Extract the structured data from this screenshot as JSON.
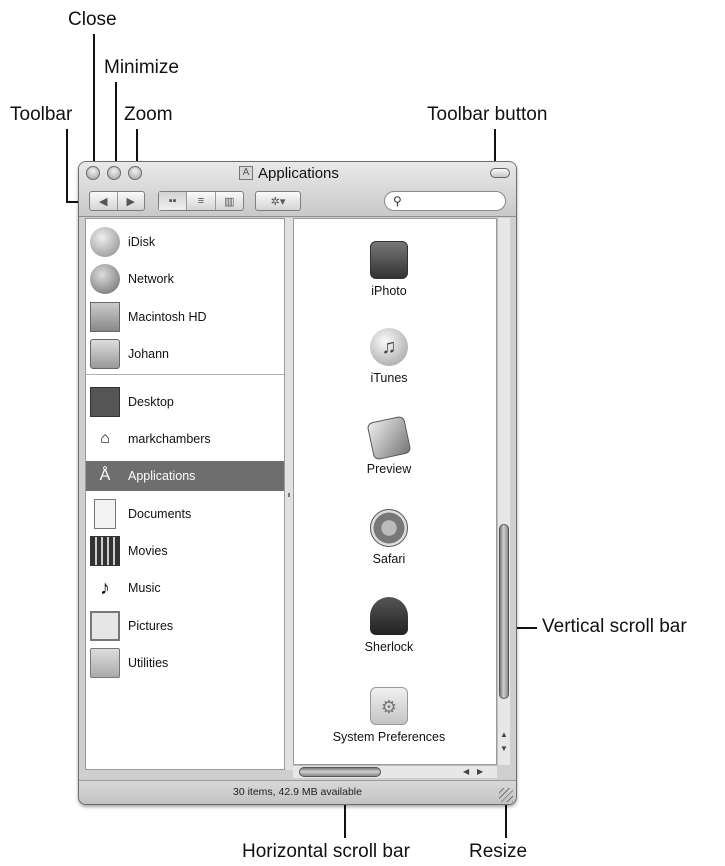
{
  "callouts": {
    "close": "Close",
    "minimize": "Minimize",
    "toolbar": "Toolbar",
    "zoom": "Zoom",
    "toolbar_button": "Toolbar button",
    "vertical_scroll_bar": "Vertical scroll bar",
    "horizontal_scroll_bar": "Horizontal scroll bar",
    "resize": "Resize"
  },
  "window": {
    "title": "Applications",
    "status": "30 items, 42.9 MB available"
  },
  "toolbar": {
    "back_glyph": "◀",
    "forward_glyph": "▶",
    "view_icon_glyph": "▪▪",
    "view_list_glyph": "≡",
    "view_column_glyph": "▥",
    "action_glyph": "✲▾",
    "search_glyph": "⚲"
  },
  "sidebar": {
    "items": [
      {
        "label": "iDisk",
        "icon": "idisk-icon"
      },
      {
        "label": "Network",
        "icon": "network-icon"
      },
      {
        "label": "Macintosh HD",
        "icon": "hard-drive-icon"
      },
      {
        "label": "Johann",
        "icon": "external-drive-icon"
      },
      {
        "label": "Desktop",
        "icon": "desktop-icon"
      },
      {
        "label": "markchambers",
        "icon": "home-icon"
      },
      {
        "label": "Applications",
        "icon": "applications-icon",
        "selected": true
      },
      {
        "label": "Documents",
        "icon": "documents-icon"
      },
      {
        "label": "Movies",
        "icon": "movies-icon"
      },
      {
        "label": "Music",
        "icon": "music-icon"
      },
      {
        "label": "Pictures",
        "icon": "pictures-icon"
      },
      {
        "label": "Utilities",
        "icon": "utilities-folder-icon"
      }
    ]
  },
  "apps": [
    {
      "label": "iPhoto",
      "icon": "iphoto-icon"
    },
    {
      "label": "iTunes",
      "icon": "itunes-icon"
    },
    {
      "label": "Preview",
      "icon": "preview-icon"
    },
    {
      "label": "Safari",
      "icon": "safari-icon"
    },
    {
      "label": "Sherlock",
      "icon": "sherlock-icon"
    },
    {
      "label": "System Preferences",
      "icon": "system-preferences-icon"
    }
  ]
}
